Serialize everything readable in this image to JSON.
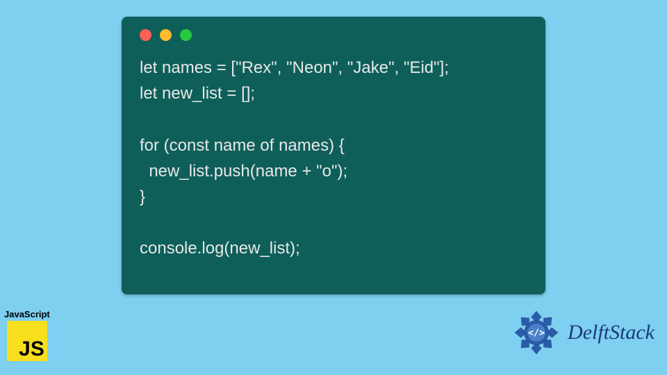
{
  "code": {
    "lines": "let names = [\"Rex\", \"Neon\", \"Jake\", \"Eid\"];\nlet new_list = [];\n\nfor (const name of names) {\n  new_list.push(name + \"o\");\n}\n\nconsole.log(new_list);"
  },
  "js_badge": {
    "label": "JavaScript",
    "logo_text": "JS"
  },
  "brand": {
    "name": "DelftStack"
  },
  "colors": {
    "background": "#7ecff0",
    "code_bg": "#0e5f5a",
    "js_yellow": "#f7df1e",
    "brand_blue": "#1a3a7a"
  }
}
